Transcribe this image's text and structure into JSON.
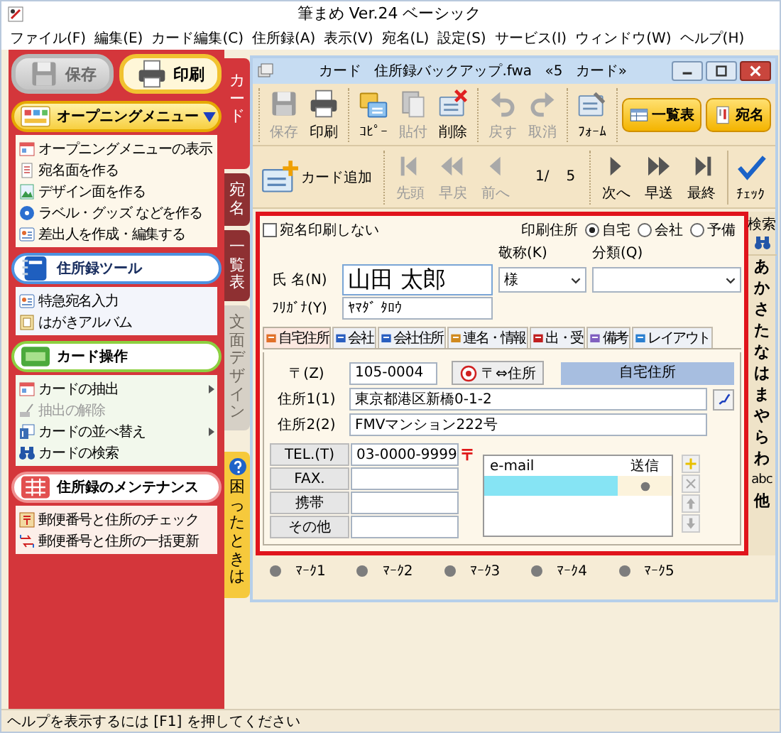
{
  "app": {
    "title": "筆まめ Ver.24 ベーシック"
  },
  "menu": [
    "ファイル(F)",
    "編集(E)",
    "カード編集(C)",
    "住所録(A)",
    "表示(V)",
    "宛名(L)",
    "設定(S)",
    "サービス(I)",
    "ウィンドウ(W)",
    "ヘルプ(H)"
  ],
  "sidebar": {
    "buttons": [
      {
        "label": "保存",
        "kind": "save",
        "disabled": true
      },
      {
        "label": "印刷",
        "kind": "print",
        "disabled": false
      }
    ],
    "sections": [
      {
        "title": "オープニングメニュー",
        "kind": "opening",
        "items": [
          {
            "label": "オープニングメニューの表示",
            "kind": "window",
            "disabled": false,
            "submenu": false
          },
          {
            "label": "宛名面を作る",
            "kind": "list",
            "disabled": false,
            "submenu": false
          },
          {
            "label": "デザイン面を作る",
            "kind": "picture",
            "disabled": false,
            "submenu": false
          },
          {
            "label": "ラベル・グッズ などを作る",
            "kind": "disc",
            "disabled": false,
            "submenu": false
          },
          {
            "label": "差出人を作成・編集する",
            "kind": "card",
            "disabled": false,
            "submenu": false
          }
        ]
      },
      {
        "title": "住所録ツール",
        "kind": "tools",
        "items": [
          {
            "label": "特急宛名入力",
            "kind": "card",
            "disabled": false,
            "submenu": false
          },
          {
            "label": "はがきアルバム",
            "kind": "album",
            "disabled": false,
            "submenu": false
          }
        ]
      },
      {
        "title": "カード操作",
        "kind": "cards",
        "items": [
          {
            "label": "カードの抽出",
            "kind": "window",
            "disabled": false,
            "submenu": true
          },
          {
            "label": "抽出の解除",
            "kind": "cleanup",
            "disabled": true,
            "submenu": false
          },
          {
            "label": "カードの並べ替え",
            "kind": "sort",
            "disabled": false,
            "submenu": true
          },
          {
            "label": "カードの検索",
            "kind": "binoculars",
            "disabled": false,
            "submenu": false
          }
        ]
      },
      {
        "title": "住所録のメンテナンス",
        "kind": "maintenance",
        "items": [
          {
            "label": "郵便番号と住所のチェック",
            "kind": "postal",
            "disabled": false,
            "submenu": false
          },
          {
            "label": "郵便番号と住所の一括更新",
            "kind": "arrows",
            "disabled": false,
            "submenu": false
          }
        ]
      }
    ]
  },
  "side_tabs": [
    {
      "label": "カード",
      "kind": "page",
      "selected": true,
      "disabled": false
    },
    {
      "label": "宛名",
      "kind": "page",
      "selected": false,
      "disabled": false
    },
    {
      "label": "一覧表",
      "kind": "page",
      "selected": false,
      "disabled": false
    },
    {
      "label": "文面デザイン",
      "kind": "page",
      "selected": false,
      "disabled": true
    },
    {
      "label": "困ったときは",
      "kind": "help",
      "selected": false,
      "disabled": false
    }
  ],
  "card_window": {
    "title": "カード 住所録バックアップ.fwa «5 カード»",
    "toolbar": {
      "groups": [
        [
          {
            "label": "保存",
            "kind": "save",
            "disabled": true
          },
          {
            "label": "印刷",
            "kind": "print",
            "disabled": false
          }
        ],
        [
          {
            "label": "ｺﾋﾟｰ",
            "kind": "copy",
            "disabled": false
          },
          {
            "label": "貼付",
            "kind": "paste",
            "disabled": true
          },
          {
            "label": "削除",
            "kind": "delete",
            "disabled": false
          }
        ],
        [
          {
            "label": "戻す",
            "kind": "undo",
            "disabled": true
          },
          {
            "label": "取消",
            "kind": "redo",
            "disabled": true
          }
        ],
        [
          {
            "label": "ﾌｫｰﾑ",
            "kind": "form",
            "disabled": false
          }
        ]
      ],
      "views": [
        {
          "label": "一覧表",
          "kind": "list"
        },
        {
          "label": "宛名",
          "kind": "address"
        }
      ]
    },
    "navbar": {
      "add": "カード追加",
      "back": [
        {
          "label": "先頭",
          "kind": "first",
          "disabled": true
        },
        {
          "label": "早戻",
          "kind": "rewind",
          "disabled": true
        },
        {
          "label": "前へ",
          "kind": "prev",
          "disabled": true
        }
      ],
      "position": "1/",
      "total": "5",
      "forward": [
        {
          "label": "次へ",
          "kind": "next",
          "disabled": false
        },
        {
          "label": "早送",
          "kind": "forward",
          "disabled": false
        },
        {
          "label": "最終",
          "kind": "last",
          "disabled": false
        }
      ],
      "check": "ﾁｪｯｸ"
    },
    "form": {
      "no_print": {
        "label": "宛名印刷しない",
        "checked": false
      },
      "print_address": {
        "label": "印刷住所",
        "options": [
          {
            "label": "自宅",
            "selected": true
          },
          {
            "label": "会社",
            "selected": false
          },
          {
            "label": "予備",
            "selected": false
          }
        ]
      },
      "name": {
        "label": "氏 名(N)",
        "value": "山田 太郎"
      },
      "honorific": {
        "label": "敬称(K)",
        "value": "様"
      },
      "category": {
        "label": "分類(Q)"
      },
      "furigana": {
        "label": "ﾌﾘｶﾞﾅ(Y)",
        "value": "ﾔﾏﾀﾞ ﾀﾛｳ"
      },
      "tabs": [
        {
          "label": "自宅住所",
          "kind": "home",
          "selected": true
        },
        {
          "label": "会社",
          "kind": "company",
          "selected": false
        },
        {
          "label": "会社住所",
          "kind": "company-address",
          "selected": false
        },
        {
          "label": "連名・情報",
          "kind": "people",
          "selected": false
        },
        {
          "label": "出・受",
          "kind": "mail",
          "selected": false
        },
        {
          "label": "備考",
          "kind": "note",
          "selected": false
        },
        {
          "label": "レイアウト",
          "kind": "layout",
          "selected": false
        }
      ],
      "postal": {
        "label": "〒(Z)",
        "value": "105-0004"
      },
      "convert_button": "〒⇔住所",
      "address_type": "自宅住所",
      "address1": {
        "label": "住所1(1)",
        "value": "東京都港区新橋0-1-2"
      },
      "address2": {
        "label": "住所2(2)",
        "value": "FMVマンション222号"
      },
      "phones": [
        {
          "label": "TEL.(T)",
          "kind": "tel",
          "value": "03-0000-9999"
        },
        {
          "label": "FAX.",
          "kind": "fax"
        },
        {
          "label": "携帯",
          "kind": "mobile"
        },
        {
          "label": "その他",
          "kind": "other"
        }
      ],
      "email": {
        "columns": [
          "e-mail",
          "送信"
        ],
        "rows": [
          {
            "selected": true,
            "send": true
          }
        ],
        "buttons": [
          {
            "kind": "add",
            "disabled": false
          },
          {
            "kind": "remove",
            "disabled": true
          },
          {
            "kind": "up",
            "disabled": true
          },
          {
            "kind": "down",
            "disabled": true
          }
        ]
      }
    },
    "index": {
      "search": "検索",
      "letters": [
        "あ",
        "か",
        "さ",
        "た",
        "な",
        "は",
        "ま",
        "や",
        "ら",
        "わ",
        "abc",
        "他"
      ]
    },
    "marks": [
      {
        "label": "ﾏｰｸ1",
        "on": false
      },
      {
        "label": "ﾏｰｸ2",
        "on": false
      },
      {
        "label": "ﾏｰｸ3",
        "on": false
      },
      {
        "label": "ﾏｰｸ4",
        "on": false
      },
      {
        "label": "ﾏｰｸ5",
        "on": false
      }
    ]
  },
  "status_bar": "ヘルプを表示するには [F1] を押してください"
}
